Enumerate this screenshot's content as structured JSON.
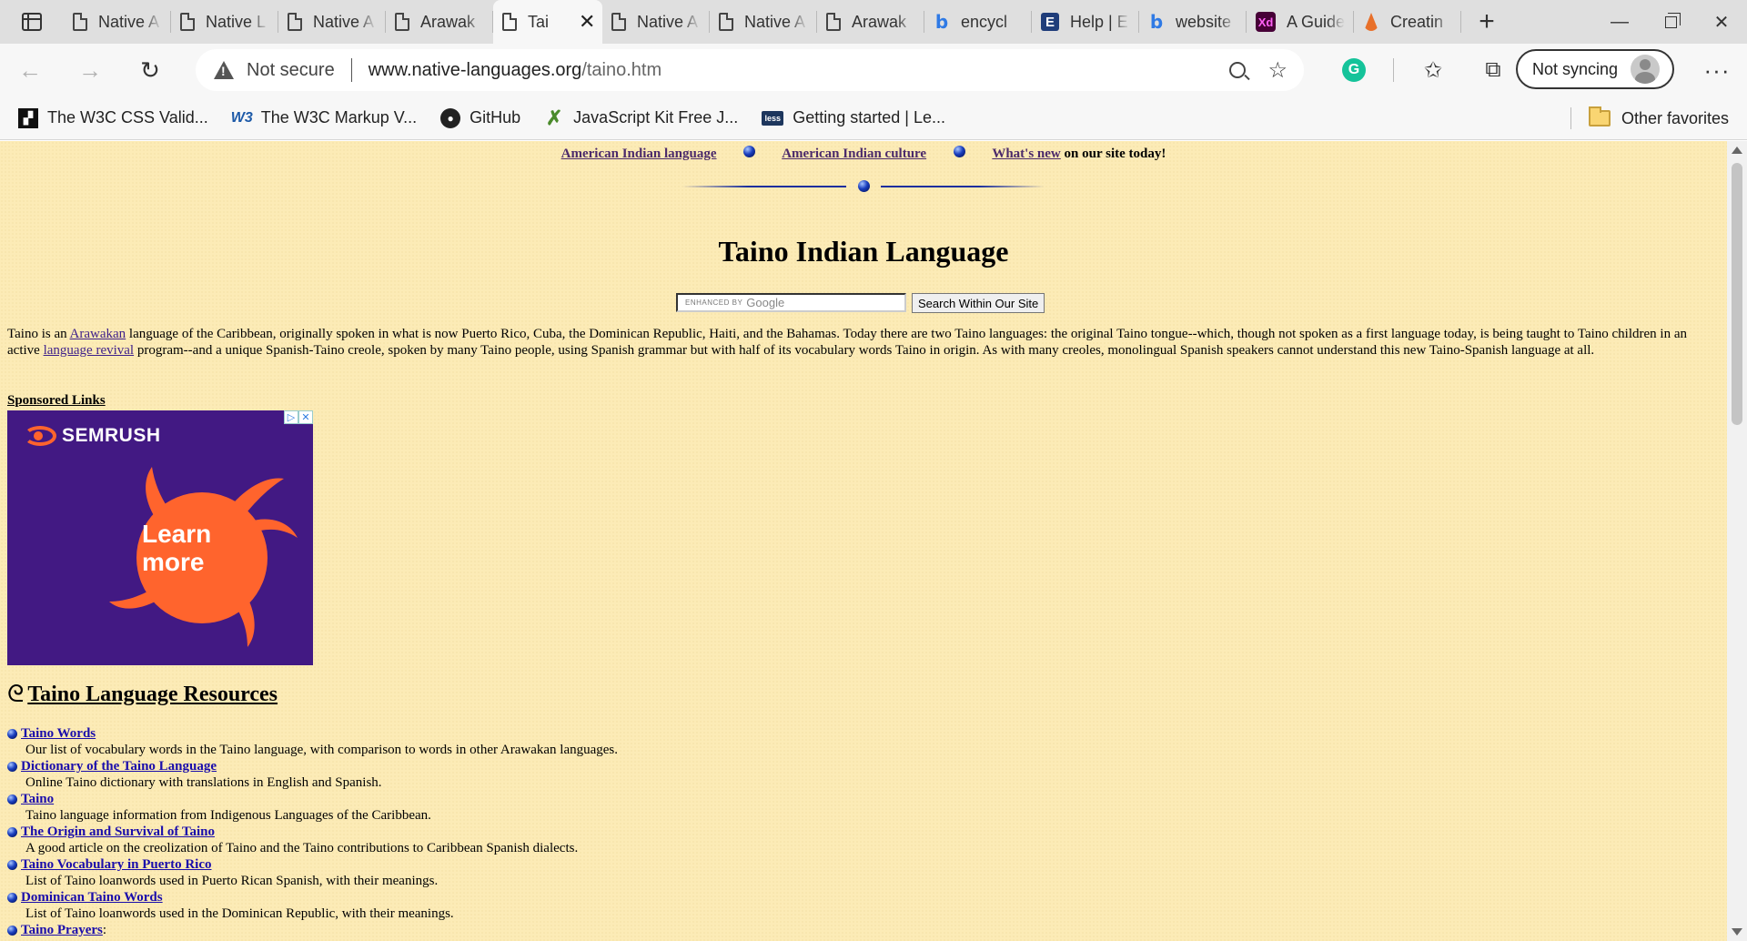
{
  "browser": {
    "tabs": [
      {
        "label": "Native A",
        "icon": "document-icon"
      },
      {
        "label": "Native L",
        "icon": "document-icon"
      },
      {
        "label": "Native A",
        "icon": "document-icon"
      },
      {
        "label": "Arawak",
        "icon": "document-icon"
      },
      {
        "label": "Tai",
        "icon": "document-icon",
        "active": true
      },
      {
        "label": "Native A",
        "icon": "document-icon"
      },
      {
        "label": "Native A",
        "icon": "document-icon"
      },
      {
        "label": "Arawak",
        "icon": "document-icon"
      },
      {
        "label": "encycl",
        "icon": "bing-icon"
      },
      {
        "label": "Help | E",
        "icon": "e-icon"
      },
      {
        "label": "website",
        "icon": "bing-icon"
      },
      {
        "label": "A Guide",
        "icon": "xd-icon"
      },
      {
        "label": "Creatin",
        "icon": "flame-icon"
      }
    ],
    "address": {
      "security": "Not secure",
      "host": "www.native-languages.org",
      "path": "/taino.htm"
    },
    "profile": {
      "label": "Not syncing"
    },
    "favorites": [
      {
        "label": "The W3C CSS Valid...",
        "icon": "w3c-icon"
      },
      {
        "label": "The W3C Markup V...",
        "icon": "w3-icon"
      },
      {
        "label": "GitHub",
        "icon": "github-icon"
      },
      {
        "label": "JavaScript Kit Free J...",
        "icon": "jskit-icon"
      },
      {
        "label": "Getting started | Le...",
        "icon": "less-icon"
      }
    ],
    "other_favorites": "Other favorites"
  },
  "page": {
    "nav": {
      "link1": "American Indian language",
      "link2": "American Indian culture",
      "link3": "What's new",
      "suffix": " on our site today!"
    },
    "title": "Taino Indian Language",
    "search": {
      "enhanced_by": "ENHANCED BY",
      "google": "Google",
      "button": "Search Within Our Site"
    },
    "intro": {
      "t1": "Taino is an ",
      "a1": "Arawakan",
      "t2": " language of the Caribbean, originally spoken in what is now Puerto Rico, Cuba, the Dominican Republic, Haiti, and the Bahamas. Today there are two Taino languages: the original Taino tongue--which, though not spoken as a first language today, is being taught to Taino children in an active ",
      "a2": "language revival",
      "t3": " program--and a unique Spanish-Taino creole, spoken by many Taino people, using Spanish grammar but with half of its vocabulary words Taino in origin. As with many creoles, monolingual Spanish speakers cannot understand this new Taino-Spanish language at all."
    },
    "sponsored": "Sponsored Links",
    "ad": {
      "brand": "SEMRUSH",
      "cta_line1": "Learn",
      "cta_line2": "more",
      "bg": "#421983",
      "accent": "#ff642d"
    },
    "resources": {
      "spiral": "ᘓ",
      "heading": "Taino Language Resources",
      "items": [
        {
          "title": "Taino Words",
          "desc": "Our list of vocabulary words in the Taino language, with comparison to words in other Arawakan languages."
        },
        {
          "title": "Dictionary of the Taino Language",
          "desc": "Online Taino dictionary with translations in English and Spanish."
        },
        {
          "title": "Taino",
          "desc": "Taino language information from Indigenous Languages of the Caribbean."
        },
        {
          "title": "The Origin and Survival of Taino",
          "desc": "A good article on the creolization of Taino and the Taino contributions to Caribbean Spanish dialects."
        },
        {
          "title": "Taino Vocabulary in Puerto Rico",
          "desc": "List of Taino loanwords used in Puerto Rican Spanish, with their meanings."
        },
        {
          "title": "Dominican Taino Words",
          "desc": "List of Taino loanwords used in the Dominican Republic, with their meanings."
        },
        {
          "title": "Taino Prayers",
          "desc": ":"
        }
      ]
    }
  }
}
